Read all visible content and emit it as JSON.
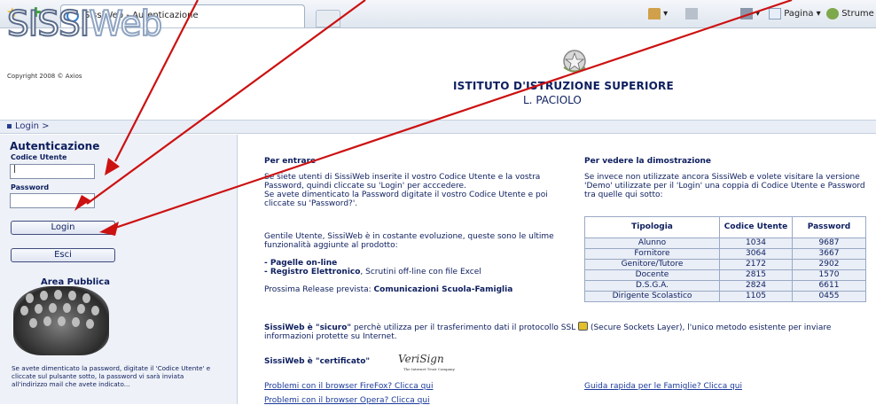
{
  "browser": {
    "tab_title": "SissiWeb - Autenticazione",
    "pagina_label": "Pagina",
    "strumenti_label": "Strume"
  },
  "logo": {
    "part1": "SISSI",
    "part2": "Web"
  },
  "copyright": "Copyright 2008 © Axios",
  "breadcrumb": "Login >",
  "header": {
    "institute_type": "ISTITUTO D'ISTRUZIONE SUPERIORE",
    "institute_name": "L. PACIOLO"
  },
  "auth": {
    "title": "Autenticazione",
    "code_label": "Codice Utente",
    "code_value": "|",
    "password_label": "Password",
    "password_value": "",
    "login_button": "Login",
    "exit_button": "Esci"
  },
  "public_area": {
    "title": "Area Pubblica",
    "note": "Se avete dimenticato la password, digitate il 'Codice Utente' e cliccate sul pulsante sotto, la password vi sarà inviata all'indirizzo mail che avete indicato..."
  },
  "enter": {
    "title": "Per entrare",
    "p1": "Se siete utenti di SissiWeb inserite il vostro Codice Utente e la vostra Password, quindi cliccate su 'Login' per acccedere.",
    "p2": "Se avete dimenticato la Password digitate il vostro Codice Utente e poi cliccate su 'Password?'.",
    "p3": "Gentile Utente, SissiWeb è in costante evoluzione, queste sono le ultime funzionalità aggiunte al prodotto:",
    "feature1": "- Pagelle on-line",
    "feature2_bold": "- Registro Elettronico",
    "feature2_rest": ", Scrutini off-line con file Excel",
    "release_prefix": "Prossima Release prevista: ",
    "release_value": "Comunicazioni Scuola-Famiglia"
  },
  "demo": {
    "title": "Per vedere la dimostrazione",
    "text": "Se invece non utilizzate ancora SissiWeb e volete visitare la versione 'Demo' utilizzate per il 'Login' una coppia di Codice Utente e Password tra quelle qui sotto:",
    "headers": [
      "Tipologia",
      "Codice Utente",
      "Password"
    ],
    "rows": [
      [
        "Alunno",
        "1034",
        "9687"
      ],
      [
        "Fornitore",
        "3064",
        "3667"
      ],
      [
        "Genitore/Tutore",
        "2172",
        "2902"
      ],
      [
        "Docente",
        "2815",
        "1570"
      ],
      [
        "D.S.G.A.",
        "2824",
        "6611"
      ],
      [
        "Dirigente Scolastico",
        "1105",
        "0455"
      ]
    ]
  },
  "secure": {
    "bold": "SissiWeb è \"sicuro\"",
    "rest": " perchè utilizza per il trasferimento dati il protocollo SSL",
    "rest2": " (Secure Sockets Layer), l'unico metodo esistente per inviare informazioni protette su Internet."
  },
  "certified": {
    "text": "SissiWeb è \"certificato\"",
    "logo": "VeriSign",
    "logo_sub": "The Internet Trust Company"
  },
  "links": {
    "firefox": "Problemi con il browser FireFox? Clicca qui",
    "opera": "Problemi con il browser Opera? Clicca qui",
    "families": "Guida rapida per le Famiglie? Clicca qui"
  },
  "colors": {
    "accent": "#0d1e5e",
    "arrow": "#cc1111"
  }
}
